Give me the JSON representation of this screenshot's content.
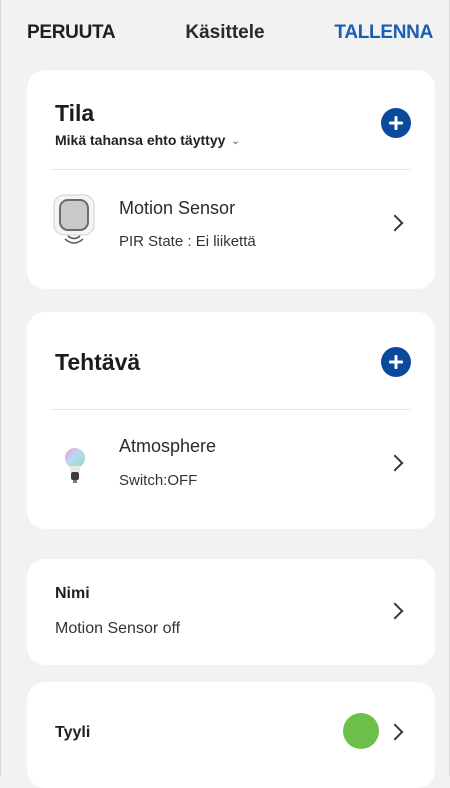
{
  "header": {
    "cancel_label": "PERUUTA",
    "title": "Käsittele",
    "save_label": "TALLENNA"
  },
  "condition": {
    "title": "Tila",
    "mode": "Mikä tahansa ehto täyttyy",
    "items": [
      {
        "name": "Motion Sensor",
        "detail": "PIR State : Ei liikettä",
        "icon": "motion-sensor-icon"
      }
    ]
  },
  "task": {
    "title": "Tehtävä",
    "items": [
      {
        "name": "Atmosphere",
        "detail": "Switch:OFF",
        "icon": "bulb-icon"
      }
    ]
  },
  "name_field": {
    "label": "Nimi",
    "value": "Motion Sensor off"
  },
  "style_field": {
    "label": "Tyyli",
    "color": "#6cc04a"
  },
  "colors": {
    "accent": "#0b4a9b",
    "save": "#1a5db3"
  }
}
